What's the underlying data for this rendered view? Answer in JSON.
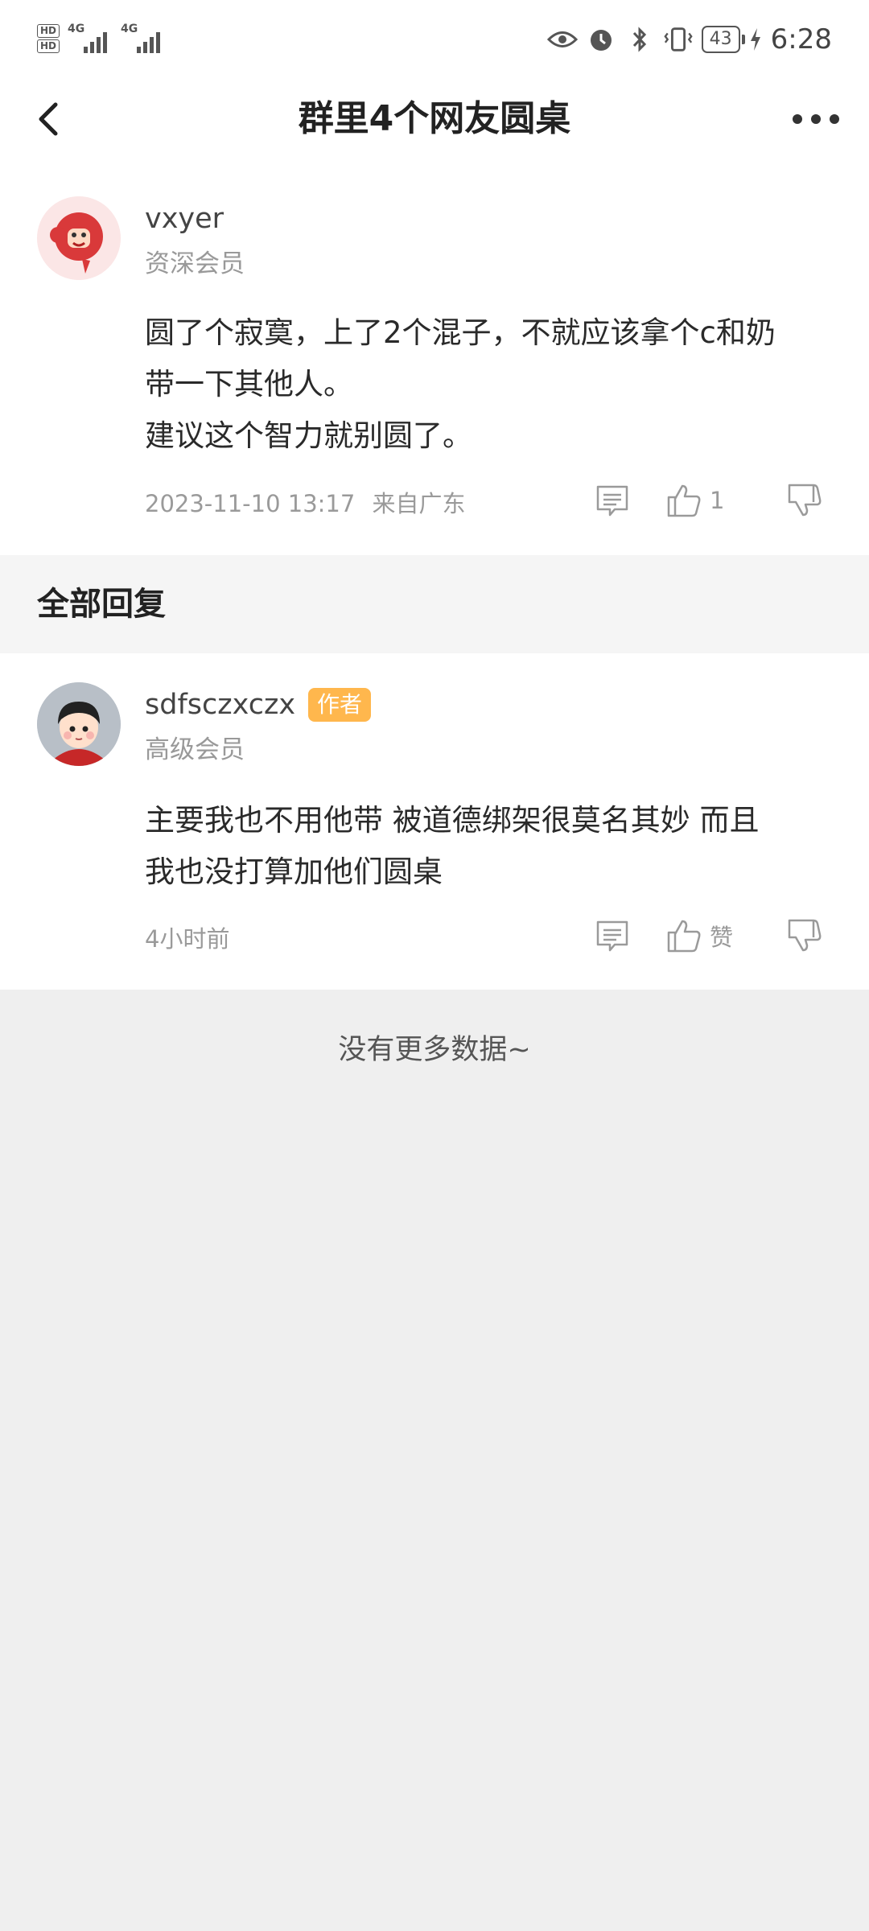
{
  "status_bar": {
    "sim1": "HD",
    "sim2": "HD",
    "net1": "4G",
    "net2": "4G",
    "battery": "43",
    "time": "6:28"
  },
  "header": {
    "title": "群里4个网友圆桌"
  },
  "post": {
    "username": "vxyer",
    "level": "资深会员",
    "content_lines": [
      "圆了个寂寞，上了2个混子，不就应该拿个c和奶",
      "带一下其他人。",
      "建议这个智力就别圆了。"
    ],
    "timestamp": "2023-11-10 13:17",
    "location": "来自广东",
    "like_count": "1"
  },
  "section": {
    "title": "全部回复"
  },
  "reply": {
    "username": "sdfsczxczx",
    "badge": "作者",
    "level": "高级会员",
    "content_lines": [
      "主要我也不用他带 被道德绑架很莫名其妙 而且",
      "我也没打算加他们圆桌"
    ],
    "time": "4小时前",
    "like_label": "赞"
  },
  "footer": {
    "no_more": "没有更多数据~"
  }
}
